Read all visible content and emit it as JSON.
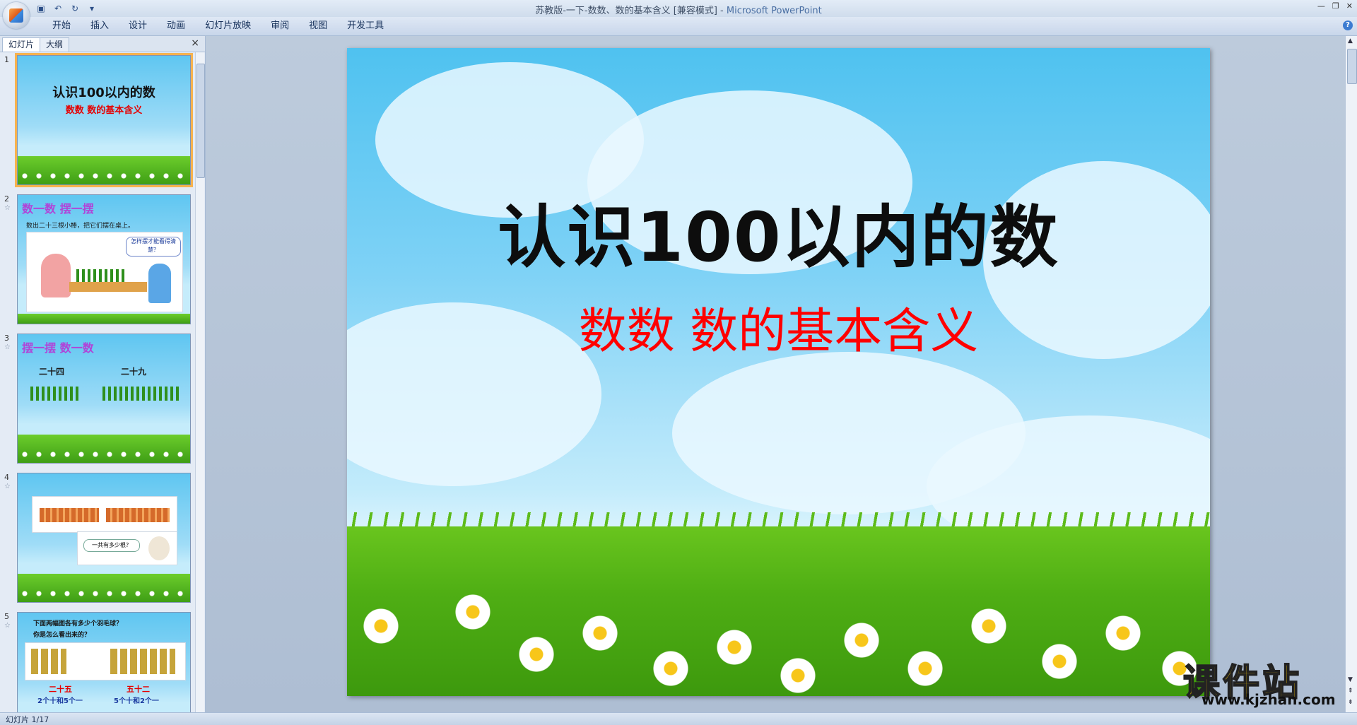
{
  "window": {
    "title": "苏教版-一下-数数、数的基本含义 [兼容模式]",
    "app_separator": " - ",
    "app_name": "Microsoft PowerPoint"
  },
  "ribbon": {
    "tabs": [
      "开始",
      "插入",
      "设计",
      "动画",
      "幻灯片放映",
      "审阅",
      "视图",
      "开发工具"
    ]
  },
  "left_pane": {
    "tabs": [
      "幻灯片",
      "大纲"
    ],
    "close": "×"
  },
  "thumbnails": [
    {
      "num": "1",
      "title": "认识100以内的数",
      "subtitle": "数数  数的基本含义"
    },
    {
      "num": "2",
      "heading": "数一数 摆一摆",
      "line": "数出二十三根小棒，把它们摆在桌上。",
      "bubble": "怎样摆才能看得清楚？"
    },
    {
      "num": "3",
      "heading": "摆一摆 数一数",
      "left_label": "二十四",
      "right_label": "二十九"
    },
    {
      "num": "4",
      "bubble": "一共有多少根？"
    },
    {
      "num": "5",
      "line1": "下面两幅图各有多少个羽毛球？",
      "line2": "你是怎么看出来的？",
      "left_label": "二十五",
      "right_label": "五十二",
      "left_note": "2个十和5个一",
      "right_note": "5个十和2个一"
    }
  ],
  "slide": {
    "title": "认识100以内的数",
    "subtitle": "数数  数的基本含义"
  },
  "watermark": {
    "main": "课件站",
    "url": "www.kjzhan.com"
  },
  "status": {
    "text": "幻灯片 1/17"
  }
}
